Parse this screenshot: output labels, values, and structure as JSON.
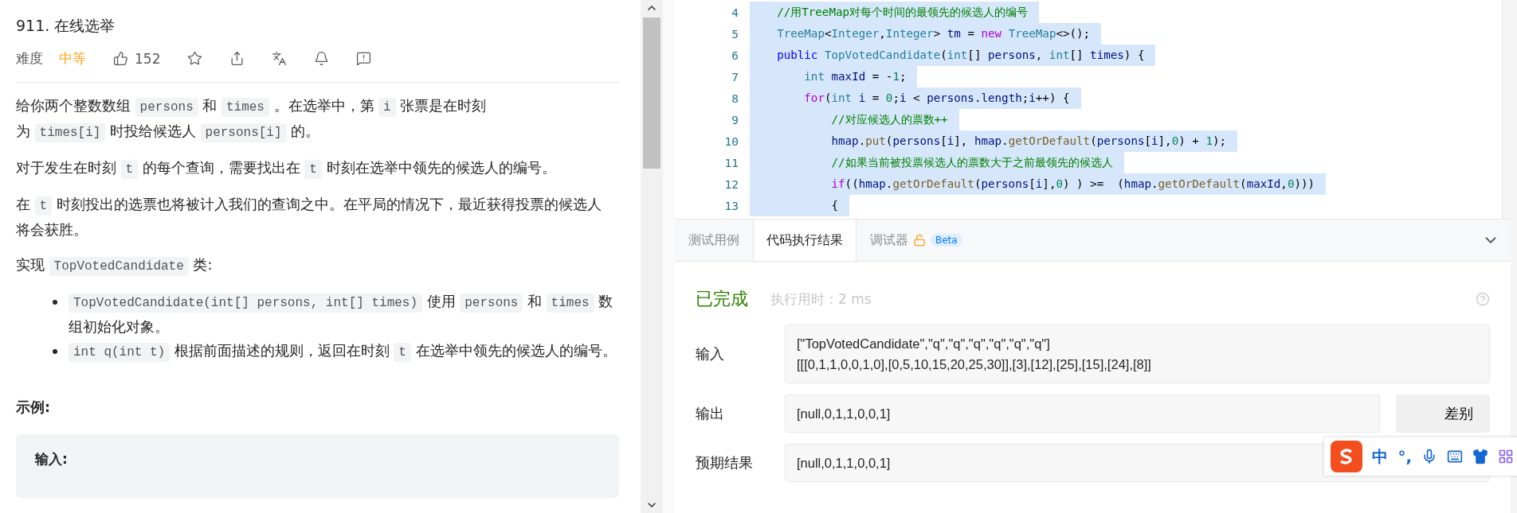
{
  "problem": {
    "title": "911. 在线选举",
    "difficulty_label": "难度",
    "difficulty": "中等",
    "likes": "152",
    "paragraphs": [
      {
        "lines": [
          [
            {
              "t": "给你两个整数数组 ",
              "kind": "text"
            },
            {
              "t": "persons",
              "kind": "code"
            },
            {
              "t": " 和 ",
              "kind": "text"
            },
            {
              "t": "times",
              "kind": "code"
            },
            {
              "t": " 。在选举中，第 ",
              "kind": "text"
            },
            {
              "t": "i",
              "kind": "code"
            },
            {
              "t": " 张票是在时刻",
              "kind": "text"
            }
          ],
          [
            {
              "t": "为 ",
              "kind": "text"
            },
            {
              "t": "times[i]",
              "kind": "code"
            },
            {
              "t": " 时投给候选人 ",
              "kind": "text"
            },
            {
              "t": "persons[i]",
              "kind": "code"
            },
            {
              "t": " 的。",
              "kind": "text"
            }
          ]
        ]
      },
      {
        "lines": [
          [
            {
              "t": "对于发生在时刻 ",
              "kind": "text"
            },
            {
              "t": "t",
              "kind": "code"
            },
            {
              "t": " 的每个查询，需要找出在 ",
              "kind": "text"
            },
            {
              "t": "t",
              "kind": "code"
            },
            {
              "t": " 时刻在选举中领先的候选人的编号。",
              "kind": "text"
            }
          ]
        ]
      },
      {
        "lines": [
          [
            {
              "t": "在 ",
              "kind": "text"
            },
            {
              "t": "t",
              "kind": "code"
            },
            {
              "t": " 时刻投出的选票也将被计入我们的查询之中。在平局的情况下，最近获得投票的候选人将会获胜。",
              "kind": "text"
            }
          ]
        ]
      },
      {
        "lines": [
          [
            {
              "t": "实现 ",
              "kind": "text"
            },
            {
              "t": "TopVotedCandidate",
              "kind": "code"
            },
            {
              "t": " 类:",
              "kind": "text"
            }
          ]
        ]
      }
    ],
    "bullets": [
      {
        "parts": [
          {
            "t": "TopVotedCandidate(int[] persons, int[] times)",
            "kind": "code"
          },
          {
            "t": " 使用 ",
            "kind": "text"
          },
          {
            "t": "persons",
            "kind": "code"
          },
          {
            "t": " 和 ",
            "kind": "text"
          },
          {
            "t": "times",
            "kind": "code"
          },
          {
            "t": " 数组初始化对象。",
            "kind": "text"
          }
        ]
      },
      {
        "parts": [
          {
            "t": "int q(int t)",
            "kind": "code"
          },
          {
            "t": " 根据前面描述的规则，返回在时刻 ",
            "kind": "text"
          },
          {
            "t": "t",
            "kind": "code"
          },
          {
            "t": " 在选举中领先的候选人的编号。",
            "kind": "text"
          }
        ]
      }
    ],
    "example_heading": "示例:",
    "example_label": "输入:"
  },
  "editor": {
    "lines": [
      {
        "num": "4",
        "selected": true,
        "tokens": [
          {
            "t": "    //用TreeMap对每个时间的最领先的候选人的编号",
            "color": "#008000"
          }
        ]
      },
      {
        "num": "5",
        "selected": true,
        "tokens": [
          {
            "t": "    TreeMap",
            "color": "#267f99"
          },
          {
            "t": "<"
          },
          {
            "t": "Integer",
            "color": "#267f99"
          },
          {
            "t": ","
          },
          {
            "t": "Integer",
            "color": "#267f99"
          },
          {
            "t": "> "
          },
          {
            "t": "tm",
            "color": "#001080"
          },
          {
            "t": " = "
          },
          {
            "t": "new",
            "color": "#af00db"
          },
          {
            "t": " TreeMap",
            "color": "#267f99"
          },
          {
            "t": "<>();"
          }
        ]
      },
      {
        "num": "6",
        "selected": true,
        "tokens": [
          {
            "t": "    public",
            "color": "#0000ff"
          },
          {
            "t": " TopVotedCandidate",
            "color": "#267f99"
          },
          {
            "t": "("
          },
          {
            "t": "int",
            "color": "#267f99"
          },
          {
            "t": "[] "
          },
          {
            "t": "persons",
            "color": "#001080"
          },
          {
            "t": ", "
          },
          {
            "t": "int",
            "color": "#267f99"
          },
          {
            "t": "[] "
          },
          {
            "t": "times",
            "color": "#001080"
          },
          {
            "t": ") {"
          }
        ]
      },
      {
        "num": "7",
        "selected": true,
        "tokens": [
          {
            "t": "        int",
            "color": "#267f99"
          },
          {
            "t": " maxId",
            "color": "#001080"
          },
          {
            "t": " = -"
          },
          {
            "t": "1",
            "color": "#098658"
          },
          {
            "t": ";"
          }
        ]
      },
      {
        "num": "8",
        "selected": true,
        "tokens": [
          {
            "t": "        for",
            "color": "#af00db"
          },
          {
            "t": "("
          },
          {
            "t": "int",
            "color": "#267f99"
          },
          {
            "t": " i",
            "color": "#001080"
          },
          {
            "t": " = "
          },
          {
            "t": "0",
            "color": "#098658"
          },
          {
            "t": ";"
          },
          {
            "t": "i",
            "color": "#001080"
          },
          {
            "t": " < "
          },
          {
            "t": "persons",
            "color": "#001080"
          },
          {
            "t": "."
          },
          {
            "t": "length",
            "color": "#001080"
          },
          {
            "t": ";"
          },
          {
            "t": "i",
            "color": "#001080"
          },
          {
            "t": "++) {"
          }
        ]
      },
      {
        "num": "9",
        "selected": true,
        "tokens": [
          {
            "t": "            //对应候选人的票数++",
            "color": "#008000"
          }
        ]
      },
      {
        "num": "10",
        "selected": true,
        "tokens": [
          {
            "t": "            hmap",
            "color": "#001080"
          },
          {
            "t": "."
          },
          {
            "t": "put",
            "color": "#795e26"
          },
          {
            "t": "("
          },
          {
            "t": "persons",
            "color": "#001080"
          },
          {
            "t": "["
          },
          {
            "t": "i",
            "color": "#001080"
          },
          {
            "t": "], "
          },
          {
            "t": "hmap",
            "color": "#001080"
          },
          {
            "t": "."
          },
          {
            "t": "getOrDefault",
            "color": "#795e26"
          },
          {
            "t": "("
          },
          {
            "t": "persons",
            "color": "#001080"
          },
          {
            "t": "["
          },
          {
            "t": "i",
            "color": "#001080"
          },
          {
            "t": "],"
          },
          {
            "t": "0",
            "color": "#098658"
          },
          {
            "t": ") + "
          },
          {
            "t": "1",
            "color": "#098658"
          },
          {
            "t": ");"
          }
        ]
      },
      {
        "num": "11",
        "selected": true,
        "tokens": [
          {
            "t": "            //如果当前被投票候选人的票数大于之前最领先的候选人",
            "color": "#008000"
          }
        ]
      },
      {
        "num": "12",
        "selected": true,
        "tokens": [
          {
            "t": "            if",
            "color": "#af00db"
          },
          {
            "t": "(("
          },
          {
            "t": "hmap",
            "color": "#001080"
          },
          {
            "t": "."
          },
          {
            "t": "getOrDefault",
            "color": "#795e26"
          },
          {
            "t": "("
          },
          {
            "t": "persons",
            "color": "#001080"
          },
          {
            "t": "["
          },
          {
            "t": "i",
            "color": "#001080"
          },
          {
            "t": "],"
          },
          {
            "t": "0",
            "color": "#098658"
          },
          {
            "t": ") ) >=  ("
          },
          {
            "t": "hmap",
            "color": "#001080"
          },
          {
            "t": "."
          },
          {
            "t": "getOrDefault",
            "color": "#795e26"
          },
          {
            "t": "("
          },
          {
            "t": "maxId",
            "color": "#001080"
          },
          {
            "t": ","
          },
          {
            "t": "0",
            "color": "#098658"
          },
          {
            "t": ")))"
          }
        ]
      },
      {
        "num": "13",
        "selected": true,
        "tokens": [
          {
            "t": "            {"
          }
        ]
      }
    ]
  },
  "console": {
    "tabs": [
      {
        "label": "测试用例",
        "selected": false
      },
      {
        "label": "代码执行结果",
        "selected": true
      },
      {
        "label": "调试器",
        "selected": false,
        "badge": "Beta"
      }
    ],
    "status": "已完成",
    "runtime": "执行用时：2 ms",
    "rows": [
      {
        "label": "输入",
        "lines": [
          "[\"TopVotedCandidate\",\"q\",\"q\",\"q\",\"q\",\"q\",\"q\"]",
          "[[[0,1,1,0,0,1,0],[0,5,10,15,20,25,30]],[3],[12],[25],[15],[24],[8]]"
        ]
      },
      {
        "label": "输出",
        "lines": [
          "[null,0,1,1,0,0,1]"
        ],
        "action": "差别"
      },
      {
        "label": "预期结果",
        "lines": [
          "[null,0,1,1,0,0,1]"
        ]
      }
    ]
  },
  "ime_toolbar": {
    "mode": "中",
    "punct": "°,"
  }
}
